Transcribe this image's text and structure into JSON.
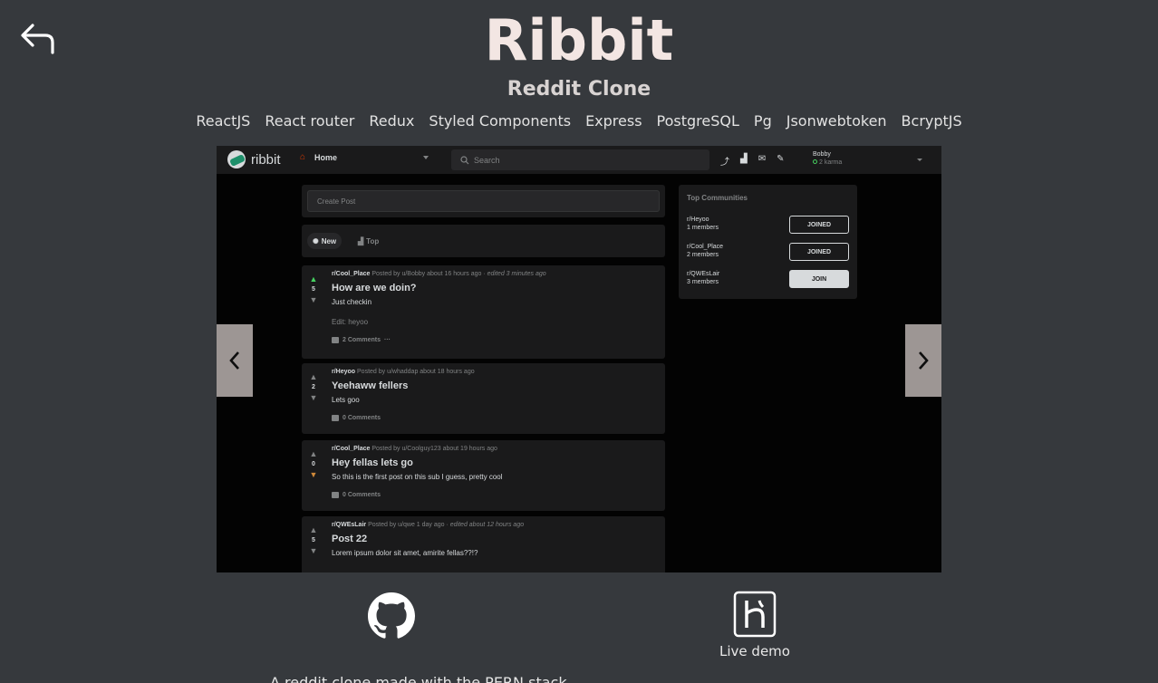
{
  "back": {
    "icon": "back-arrow-icon"
  },
  "title": "Ribbit",
  "subtitle": "Reddit Clone",
  "tech": [
    "ReactJS",
    "React router",
    "Redux",
    "Styled Components",
    "Express",
    "PostgreSQL",
    "Pg",
    "Jsonwebtoken",
    "BcryptJS"
  ],
  "screenshot": {
    "logo_text": "ribbit",
    "home_label": "Home",
    "search_placeholder": "Search",
    "user_name": "Bobby",
    "user_karma": "2 karma",
    "create_post_placeholder": "Create Post",
    "sort_new": "New",
    "sort_top": "Top",
    "posts": [
      {
        "sub": "r/Cool_Place",
        "meta": "Posted by u/Bobby about 16 hours ago",
        "edited": "· edited 3 minutes ago",
        "score": "5",
        "vote": "up",
        "title": "How are we doin?",
        "text": "Just checkin",
        "text2": "Edit: heyoo",
        "comments": "2 Comments",
        "more": "···"
      },
      {
        "sub": "r/Heyoo",
        "meta": "Posted by u/whaddap about 18 hours ago",
        "edited": "",
        "score": "2",
        "vote": "",
        "title": "Yeehaww fellers",
        "text": "Lets goo",
        "text2": "",
        "comments": "0 Comments",
        "more": ""
      },
      {
        "sub": "r/Cool_Place",
        "meta": "Posted by u/Coolguy123 about 19 hours ago",
        "edited": "",
        "score": "0",
        "vote": "down",
        "title": "Hey fellas lets go",
        "text": "So this is the first post on this sub I guess, pretty cool",
        "text2": "",
        "comments": "0 Comments",
        "more": ""
      },
      {
        "sub": "r/QWEsLair",
        "meta": "Posted by u/qwe 1 day ago",
        "edited": "· edited about 12 hours ago",
        "score": "5",
        "vote": "",
        "title": "Post 22",
        "text": "Lorem ipsum dolor sit amet, amirite fellas??!?",
        "text2": "",
        "comments": "",
        "more": ""
      }
    ],
    "top_communities": {
      "title": "Top Communities",
      "items": [
        {
          "name": "r/Heyoo",
          "members": "1 members",
          "button": "JOINED"
        },
        {
          "name": "r/Cool_Place",
          "members": "2 members",
          "button": "JOINED"
        },
        {
          "name": "r/QWEsLair",
          "members": "3 members",
          "button": "JOIN"
        }
      ]
    }
  },
  "carousel": {
    "prev_icon": "chevron-left-icon",
    "next_icon": "chevron-right-icon"
  },
  "links": {
    "github_icon": "github-icon",
    "heroku_icon": "heroku-icon",
    "live_demo": "Live demo"
  },
  "description": "A reddit clone made with the PERN stack"
}
